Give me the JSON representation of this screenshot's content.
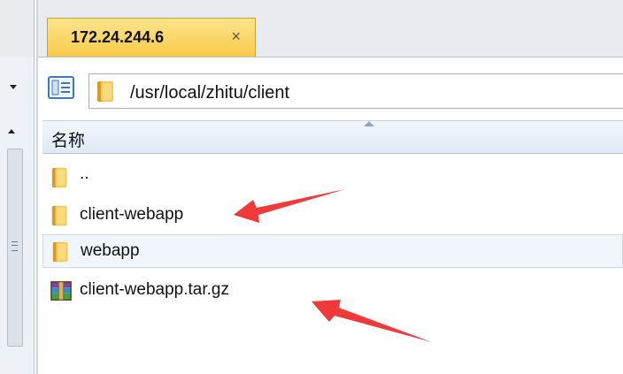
{
  "tab": {
    "title": "172.24.244.6",
    "close_glyph": "×"
  },
  "address": {
    "path": "/usr/local/zhitu/client"
  },
  "columns": {
    "name": "名称"
  },
  "files": [
    {
      "name": "..",
      "type": "folder"
    },
    {
      "name": "client-webapp",
      "type": "folder"
    },
    {
      "name": "webapp",
      "type": "folder",
      "selected": true
    },
    {
      "name": "client-webapp.tar.gz",
      "type": "archive"
    }
  ],
  "colors": {
    "tab_active": "#f7c94a",
    "annotation_arrow": "#f03a3a",
    "folder": "#e9b43c"
  },
  "icons": [
    "view-toggle-icon",
    "folder-icon",
    "archive-icon",
    "close-icon",
    "sort-ascending-icon"
  ]
}
